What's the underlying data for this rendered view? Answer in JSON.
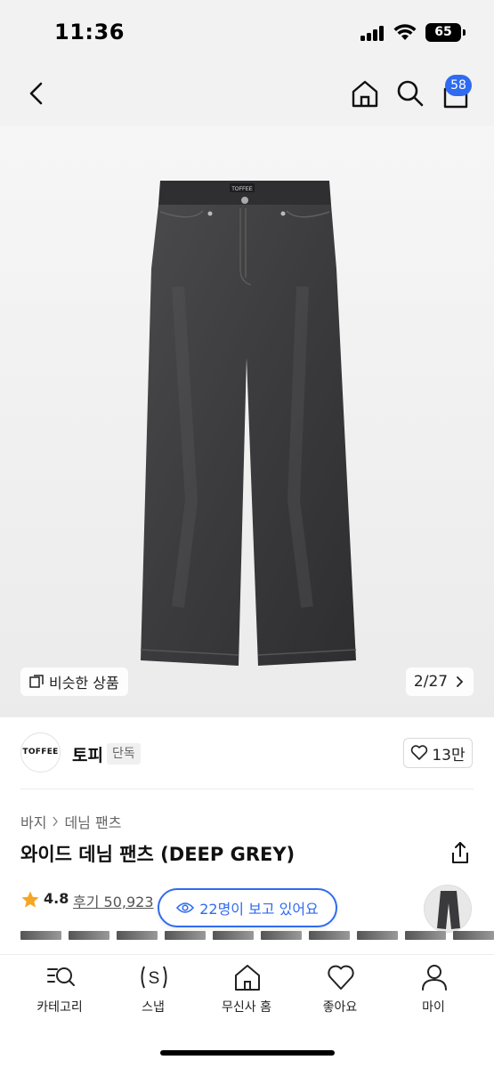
{
  "status_bar": {
    "time": "11:36",
    "battery": "65"
  },
  "nav": {
    "cart_count": "58"
  },
  "gallery": {
    "similar_label": "비슷한 상품",
    "page_indicator": "2/27",
    "garment_label": "TOFFEE"
  },
  "brand": {
    "logo_text": "TOFFEE",
    "name": "토피",
    "badge": "단독",
    "like_count": "13만"
  },
  "breadcrumb": [
    "바지",
    "데님 팬츠"
  ],
  "product": {
    "title": "와이드 데님 팬츠 (DEEP GREY)"
  },
  "rating": {
    "value": "4.8",
    "reviews": "후기 50,923",
    "viewers": "22명이 보고 있어요"
  },
  "tabs": [
    {
      "label": "카테고리",
      "icon": "category-search-icon"
    },
    {
      "label": "스냅",
      "icon": "snap-icon"
    },
    {
      "label": "무신사 홈",
      "icon": "home-icon"
    },
    {
      "label": "좋아요",
      "icon": "heart-icon"
    },
    {
      "label": "마이",
      "icon": "person-icon"
    }
  ],
  "colors": {
    "accent": "#2f6bf0",
    "denim": "#3a3a3c",
    "star": "#f5a623"
  }
}
